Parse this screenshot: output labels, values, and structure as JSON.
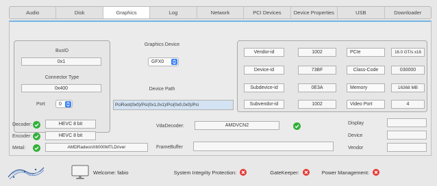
{
  "tabs": [
    {
      "label": "Audio"
    },
    {
      "label": "Disk"
    },
    {
      "label": "Graphics"
    },
    {
      "label": "Log"
    },
    {
      "label": "Network"
    },
    {
      "label": "PCI Devices"
    },
    {
      "label": "Device Properties"
    },
    {
      "label": "USB"
    },
    {
      "label": "Downloader"
    }
  ],
  "active_tab": "Graphics",
  "left_box": {
    "busid_label": "BusID",
    "busid_value": "0x1",
    "connector_type_label": "Connector Type",
    "connector_type_value": "0x400",
    "port_label": "Port",
    "port_value": "0"
  },
  "graphics_device": {
    "label": "Graphics Device",
    "selected": "GFX0"
  },
  "device_path": {
    "label": "Device Path",
    "value": "PciRoot(0x0)/Pci(0x1,0x1)/Pci(0x0,0x0)/Pci"
  },
  "ids": {
    "vendor_id_label": "Vendor-id",
    "vendor_id_value": "1002",
    "device_id_label": "Device-id",
    "device_id_value": "73BF",
    "subdevice_id_label": "Subdevice-id",
    "subdevice_id_value": "0E3A",
    "subvendor_id_label": "Subvendor-id",
    "subvendor_id_value": "1002",
    "pcie_label": "PCIe",
    "pcie_value": "16.0 GT/s x16",
    "class_code_label": "Class-Code",
    "class_code_value": "030000",
    "memory_label": "Memory",
    "memory_value": "16368 MB",
    "video_port_label": "Video Port",
    "video_port_value": "4"
  },
  "codecs": {
    "decoder_label": "Decoder:",
    "decoder_value": "HEVC 8 bit",
    "encoder_label": "Encoder:",
    "encoder_value": "HEVC 8 bit",
    "metal_label": "Metal:",
    "metal_value": "AMDRadeonX6000MTLDriver",
    "vda_label": "VdaDecoder:",
    "vda_value": "AMDVCN2",
    "framebuffer_label": "FrameBuffer",
    "framebuffer_value": ""
  },
  "display_info": {
    "display_label": "Display",
    "device_label": "Device",
    "vendor_label": "Vendor"
  },
  "status": {
    "welcome": "Welcome: fabio",
    "sip_label": "System Integrity Protection:",
    "gatekeeper_label": "GateKeeper:",
    "power_label": "Power Management:"
  },
  "colors": {
    "check_green": "#31b13a",
    "x_red": "#e53935",
    "accent_blue": "#3b82f6"
  }
}
